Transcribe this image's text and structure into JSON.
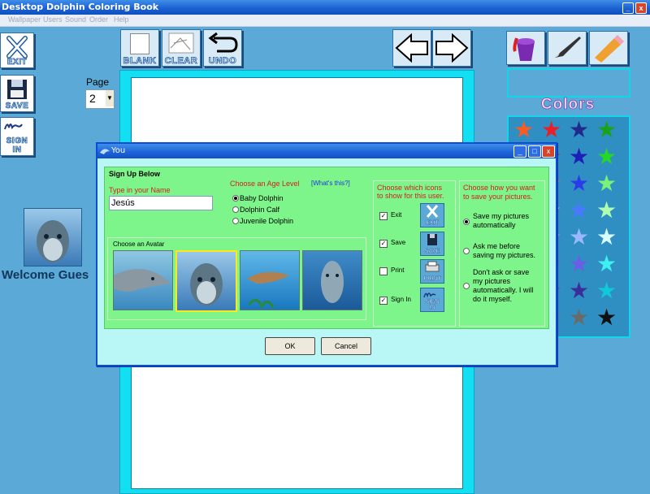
{
  "app": {
    "title": "Desktop Dolphin Coloring Book"
  },
  "menu": [
    "Wallpaper",
    "Users",
    "Sound",
    "Order",
    "Help"
  ],
  "sidebar": {
    "exit_label": "EXIT",
    "save_label": "SAVE",
    "signin_label_1": "SIGN",
    "signin_label_2": "IN"
  },
  "toolbar": {
    "blank_label": "BLANK",
    "clear_label": "CLEAR",
    "undo_label": "UNDO"
  },
  "page": {
    "label": "Page",
    "value": "2"
  },
  "welcome": "Welcome Gues",
  "colors": {
    "title": "Colors",
    "stars": [
      [
        "#ff5a1f",
        "#ee1c24",
        "#1f2a8a",
        "#1aa21a"
      ],
      [
        "#ff8a9a",
        "#c8105a",
        "#1e1fb8",
        "#24d824"
      ],
      [
        "#ffd0a0",
        "#ff6060",
        "#2a3ce8",
        "#7bf07b"
      ],
      [
        "#fff0c0",
        "#ff9aa0",
        "#4a78ff",
        "#b0ffb0"
      ],
      [
        "#f0f0ff",
        "#b888ff",
        "#9ab8ff",
        "#d8ffff"
      ],
      [
        "#f4e4ff",
        "#9b3fe0",
        "#6c5ce8",
        "#40f0f0"
      ],
      [
        "#e0d0ff",
        "#8a2ad8",
        "#3a2e9a",
        "#10c8d8"
      ],
      [
        "#c0c0c0",
        "#808080",
        "#6a6a6a",
        "#101010"
      ]
    ]
  },
  "dialog": {
    "title": "You",
    "heading": "Sign Up Below",
    "name_label": "Type in your Name",
    "name_value": "Jesús",
    "age_label": "Choose an Age Level",
    "whats_this": "[What's this?]",
    "age_options": [
      "Baby Dolphin",
      "Dolphin Calf",
      "Juvenile Dolphin"
    ],
    "avatar_label": "Choose an Avatar",
    "icons_label_1": "Choose which icons",
    "icons_label_2": "to show for this user.",
    "icon_options": [
      {
        "label": "Exit",
        "checked": true,
        "btn": "EXIT"
      },
      {
        "label": "Save",
        "checked": true,
        "btn": "SAVE"
      },
      {
        "label": "Print",
        "checked": false,
        "btn": "PRINT"
      },
      {
        "label": "Sign In",
        "checked": true,
        "btn1": "SIGN",
        "btn2": "IN"
      }
    ],
    "save_label_1": "Choose how you want",
    "save_label_2": "to save your pictures.",
    "save_options": [
      [
        "Save my pictures",
        "automatically"
      ],
      [
        "Ask me before",
        "saving my pictures."
      ],
      [
        "Don't ask or save",
        "my pictures",
        "automatically.  I will",
        "do it myself."
      ]
    ],
    "ok_label": "OK",
    "cancel_label": "Cancel"
  }
}
